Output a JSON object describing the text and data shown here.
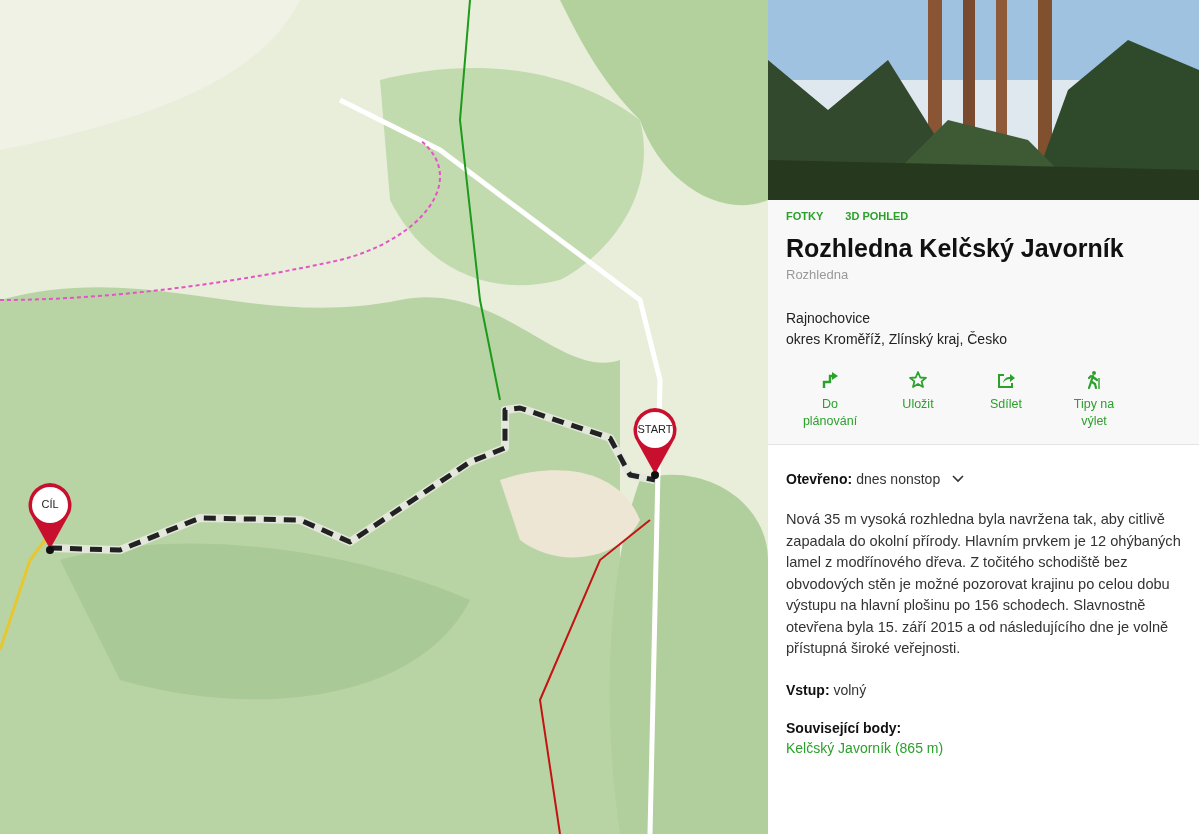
{
  "map": {
    "kind": "picture",
    "pins": [
      {
        "kind": "start",
        "label": "START"
      },
      {
        "kind": "end",
        "label": "CÍL"
      }
    ]
  },
  "tabs": [
    {
      "label": "FOTKY"
    },
    {
      "label": "3D POHLED"
    }
  ],
  "title": "Rozhledna Kelčský Javorník",
  "category": "Rozhledna",
  "address": [
    "Rajnochovice",
    "okres Kroměříž, Zlínský kraj, Česko"
  ],
  "actions": [
    {
      "kind": "route",
      "label": "Do plánování"
    },
    {
      "kind": "star",
      "label": "Uložit"
    },
    {
      "kind": "share",
      "label": "Sdílet"
    },
    {
      "kind": "hiker",
      "label": "Tipy na výlet"
    }
  ],
  "opening": {
    "label": "Otevřeno:",
    "value": "dnes nonstop",
    "expanded": false
  },
  "description": "Nová 35 m vysoká rozhledna byla navržena tak, aby citlivě zapadala do okolní přírody. Hlavním prvkem je 12 ohýbaných lamel z modřínového dřeva. Z točitého schodiště bez obvodových stěn je možné pozorovat krajinu po celou dobu výstupu na hlavní plošinu po 156 schodech. Slavnostně otevřena byla 15. září 2015 a od následujícího dne je volně přístupná široké veřejnosti.",
  "entry": {
    "label": "Vstup:",
    "value": "volný"
  },
  "related": {
    "label": "Související body:",
    "items": [
      "Kelčský Javorník (865 m)"
    ]
  }
}
